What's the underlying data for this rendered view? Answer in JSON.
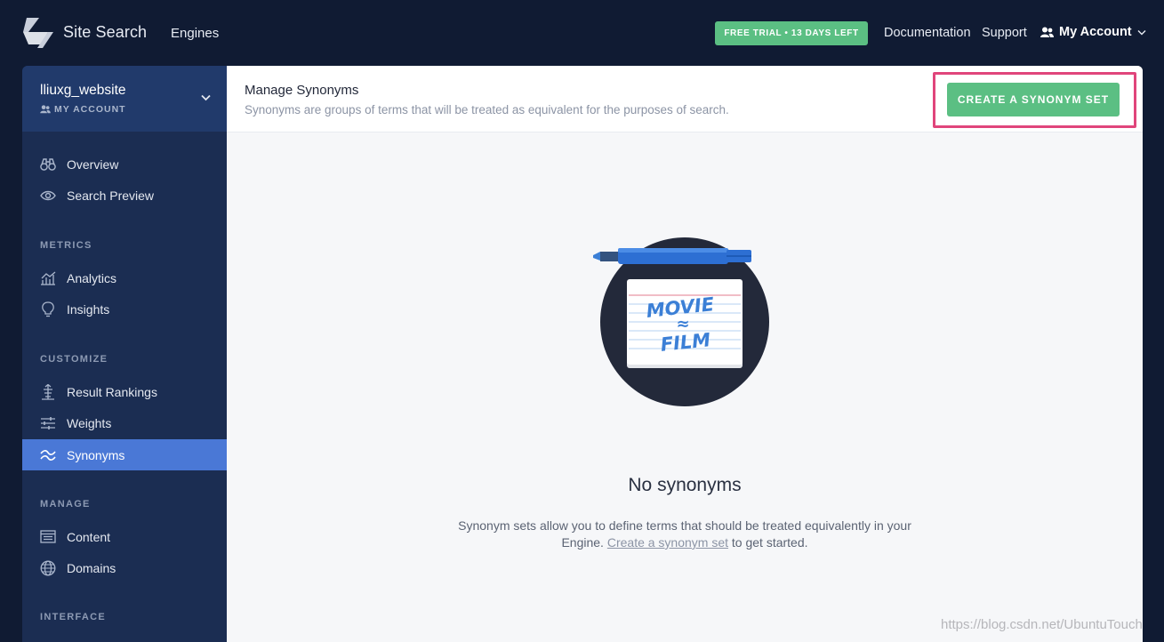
{
  "topbar": {
    "brand": "Site Search",
    "engines": "Engines",
    "trial_badge": "FREE TRIAL • 13 DAYS LEFT",
    "documentation": "Documentation",
    "support": "Support",
    "account": "My Account"
  },
  "sidebar": {
    "engine_name": "lliuxg_website",
    "engine_sub": "MY ACCOUNT",
    "items_top": [
      {
        "label": "Overview",
        "icon": "binoculars-icon"
      },
      {
        "label": "Search Preview",
        "icon": "eye-icon"
      }
    ],
    "metrics_label": "METRICS",
    "items_metrics": [
      {
        "label": "Analytics",
        "icon": "chart-icon"
      },
      {
        "label": "Insights",
        "icon": "lightbulb-icon"
      }
    ],
    "customize_label": "CUSTOMIZE",
    "items_customize": [
      {
        "label": "Result Rankings",
        "icon": "rankings-icon"
      },
      {
        "label": "Weights",
        "icon": "sliders-icon"
      },
      {
        "label": "Synonyms",
        "icon": "approx-icon",
        "active": true
      }
    ],
    "manage_label": "MANAGE",
    "items_manage": [
      {
        "label": "Content",
        "icon": "list-icon"
      },
      {
        "label": "Domains",
        "icon": "globe-icon"
      }
    ],
    "interface_label": "INTERFACE"
  },
  "main": {
    "title": "Manage Synonyms",
    "subtitle": "Synonyms are groups of terms that will be treated as equivalent for the purposes of search.",
    "create_button": "CREATE A SYNONYM SET",
    "empty_title": "No synonyms",
    "empty_desc_before": "Synonym sets allow you to define terms that should be treated equivalently in your Engine. ",
    "empty_desc_link": "Create a synonym set",
    "empty_desc_after": " to get started.",
    "card_word_1": "MOVIE",
    "card_symbol": "≈",
    "card_word_2": "FILM"
  },
  "watermark": "https://blog.csdn.net/UbuntuTouch",
  "colors": {
    "background": "#101b33",
    "sidebar": "#1b2d52",
    "active": "#4a78d6",
    "accent_green": "#5bbf83",
    "highlight": "#e0457b"
  }
}
